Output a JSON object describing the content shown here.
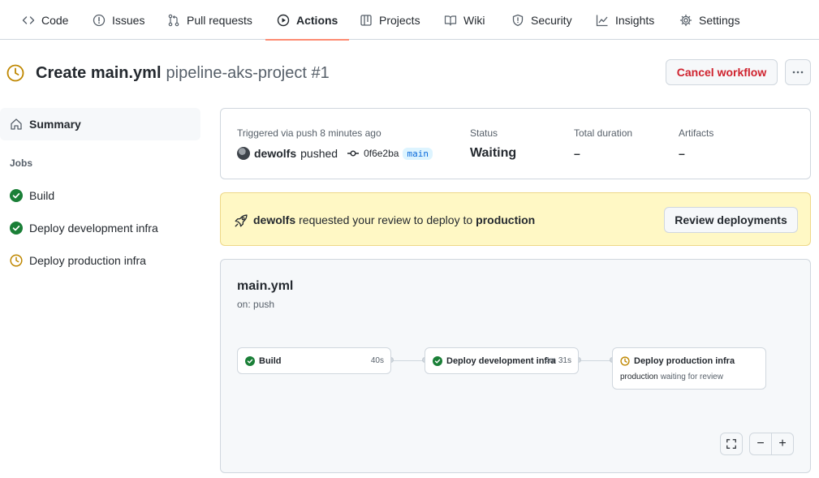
{
  "colors": {
    "accent_underline": "#fd8c73",
    "success": "#1a7f37",
    "pending": "#bf8700",
    "danger": "#cf222e",
    "branch_bg": "#ddf4ff",
    "banner_bg": "#fff8c5"
  },
  "nav": {
    "tabs": [
      {
        "label": "Code",
        "icon": "code-icon"
      },
      {
        "label": "Issues",
        "icon": "issue-opened-icon"
      },
      {
        "label": "Pull requests",
        "icon": "git-pull-request-icon"
      },
      {
        "label": "Actions",
        "icon": "play-icon",
        "active": true
      },
      {
        "label": "Projects",
        "icon": "table-icon"
      },
      {
        "label": "Wiki",
        "icon": "book-icon"
      },
      {
        "label": "Security",
        "icon": "shield-icon"
      },
      {
        "label": "Insights",
        "icon": "graph-icon"
      },
      {
        "label": "Settings",
        "icon": "gear-icon"
      }
    ]
  },
  "header": {
    "title": "Create main.yml",
    "subtitle": "pipeline-aks-project #1",
    "cancel_label": "Cancel workflow"
  },
  "sidebar": {
    "summary_label": "Summary",
    "jobs_heading": "Jobs",
    "jobs": [
      {
        "label": "Build",
        "status": "success"
      },
      {
        "label": "Deploy development infra",
        "status": "success"
      },
      {
        "label": "Deploy production infra",
        "status": "waiting"
      }
    ]
  },
  "summary": {
    "trigger_label": "Triggered via push 8 minutes ago",
    "actor": "dewolfs",
    "action": "pushed",
    "commit": "0f6e2ba",
    "branch": "main",
    "status_label": "Status",
    "status_value": "Waiting",
    "duration_label": "Total duration",
    "duration_value": "–",
    "artifacts_label": "Artifacts",
    "artifacts_value": "–"
  },
  "review": {
    "actor": "dewolfs",
    "message": "requested your review to deploy to",
    "environment": "production",
    "button_label": "Review deployments"
  },
  "workflow": {
    "file": "main.yml",
    "trigger": "on: push",
    "nodes": [
      {
        "label": "Build",
        "duration": "40s",
        "status": "success"
      },
      {
        "label": "Deploy development infra",
        "duration": "4m 31s",
        "status": "success"
      },
      {
        "label": "Deploy production infra",
        "status": "waiting",
        "env": "production",
        "note": "waiting for review"
      }
    ],
    "zoom": {
      "fullscreen": "fullscreen-icon",
      "zoom_out": "−",
      "zoom_in": "+"
    }
  }
}
